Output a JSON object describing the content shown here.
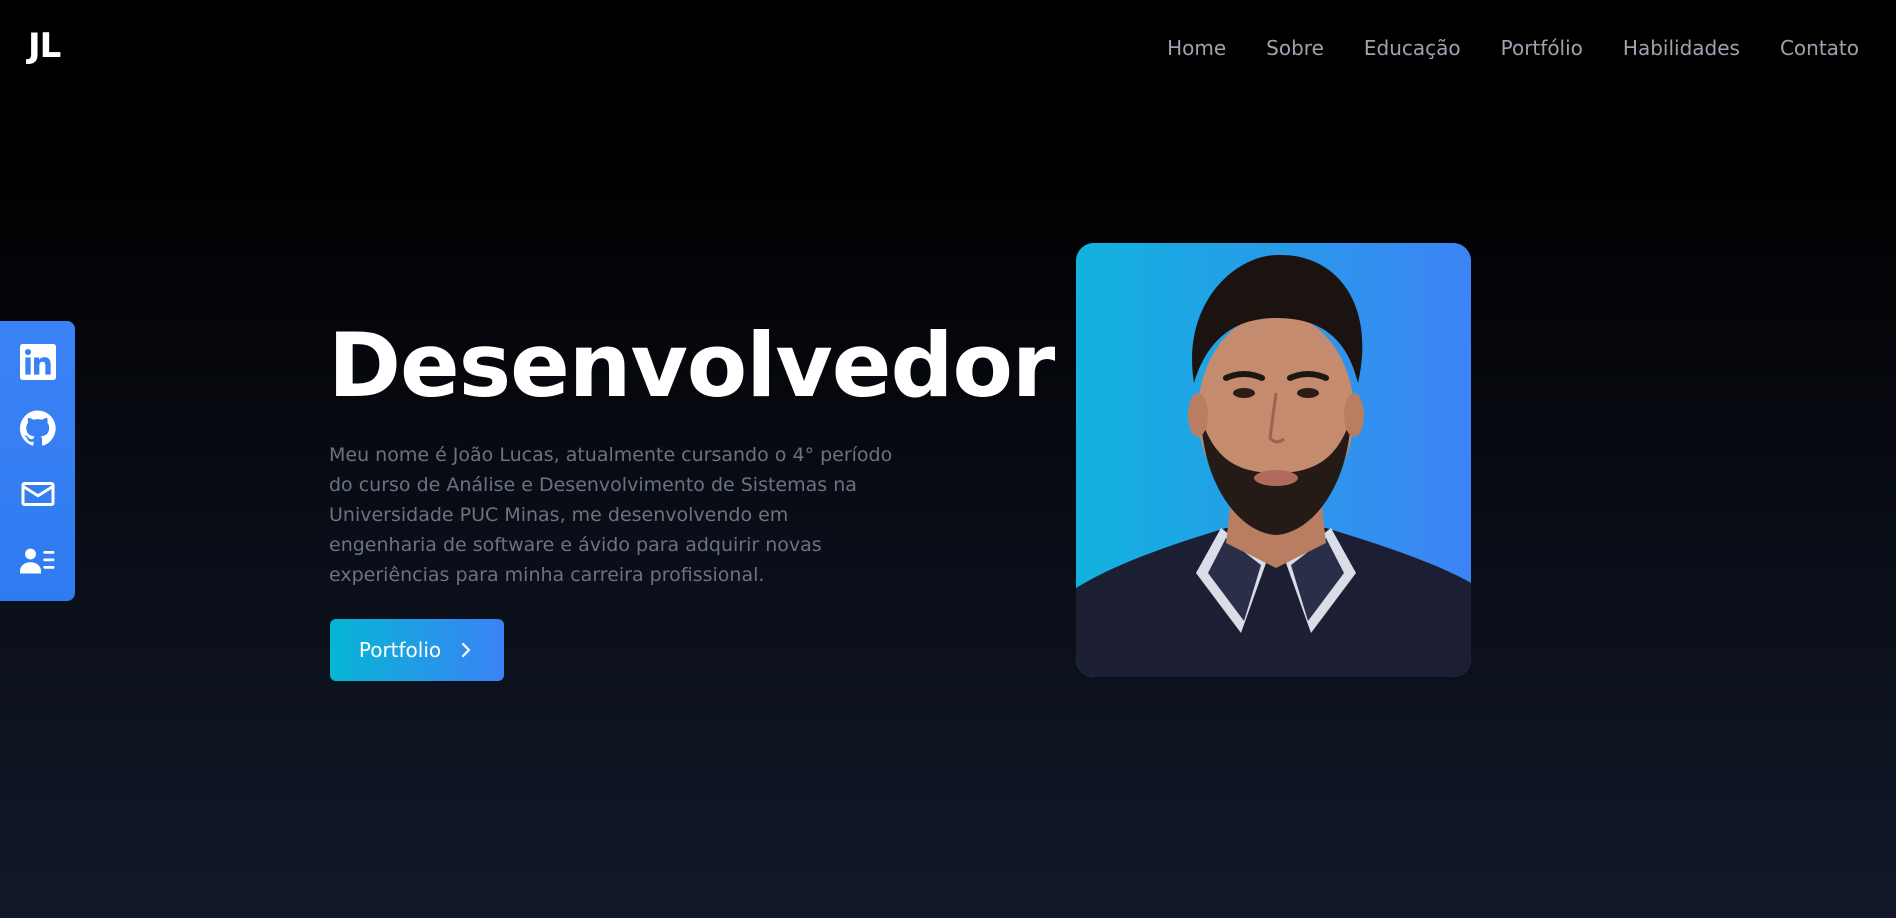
{
  "header": {
    "logo": "JL",
    "nav": [
      "Home",
      "Sobre",
      "Educação",
      "Portfólio",
      "Habilidades",
      "Contato"
    ]
  },
  "social": {
    "items": [
      {
        "name": "linkedin",
        "icon": "linkedin-icon"
      },
      {
        "name": "github",
        "icon": "github-icon"
      },
      {
        "name": "email",
        "icon": "mail-icon"
      },
      {
        "name": "resume",
        "icon": "user-list-icon"
      }
    ]
  },
  "hero": {
    "title": "Desenvolvedor",
    "description": "Meu nome é João Lucas, atualmente cursando o 4° período do curso de Análise e Desenvolvimento de Sistemas na Universidade PUC Minas, me desenvolvendo em engenharia de software e ávido para adquirir novas experiências para minha carreira profissional.",
    "cta_label": "Portfolio",
    "cta_icon": "chevron-right-icon"
  },
  "colors": {
    "accent_start": "#06b6d4",
    "accent_end": "#3b82f6",
    "nav_text": "#9ca3af",
    "body_text": "#6b7280"
  }
}
